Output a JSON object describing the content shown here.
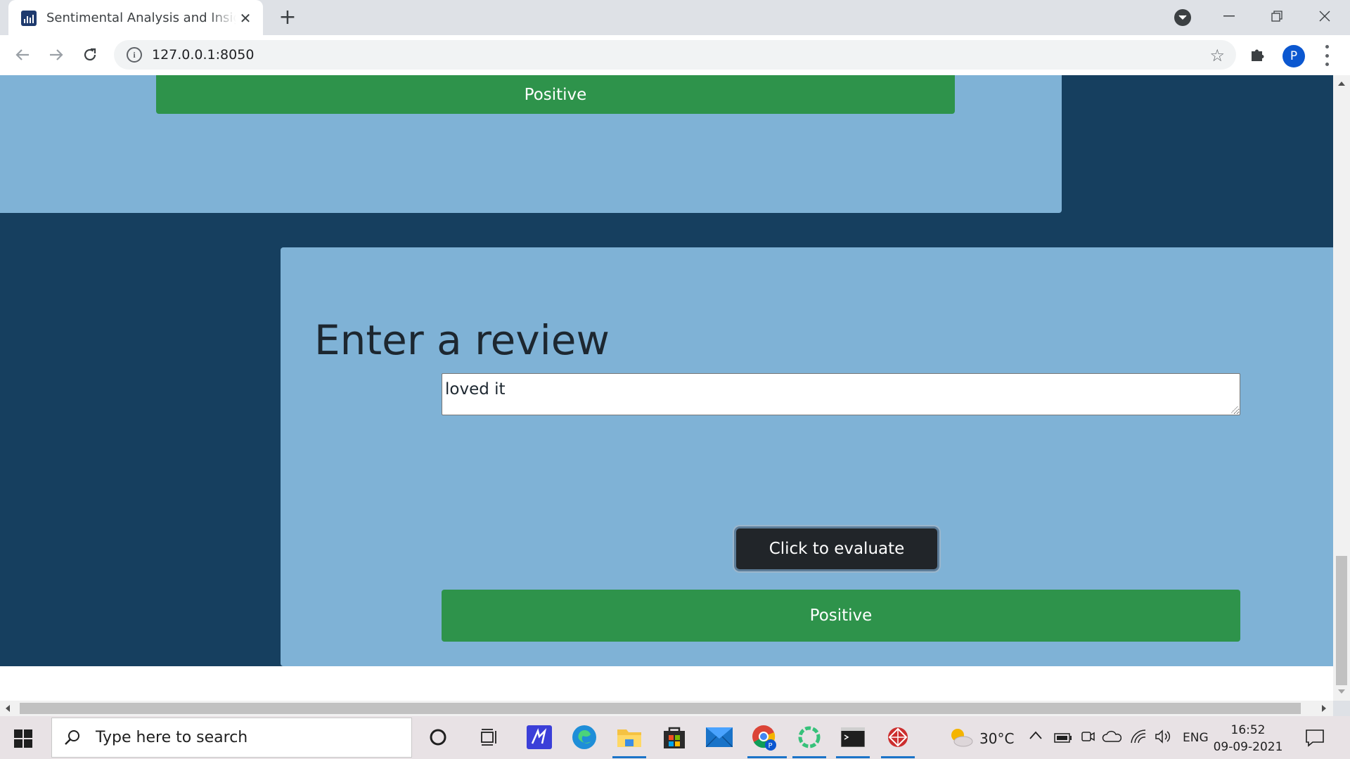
{
  "browser": {
    "tab_title": "Sentimental Analysis and Insights",
    "url": "127.0.0.1:8050",
    "profile_initial": "P"
  },
  "page": {
    "top_result": "Positive",
    "heading": "Enter a review",
    "review_value": "loved it",
    "evaluate_label": "Click to evaluate",
    "result": "Positive"
  },
  "taskbar": {
    "search_placeholder": "Type here to search",
    "weather": "30°C",
    "language": "ENG",
    "time": "16:52",
    "date": "09-09-2021"
  },
  "colors": {
    "page_background": "#163f5f",
    "card_background": "#7fb2d6",
    "success": "#2e934b",
    "button_dark": "#212529"
  },
  "icons": [
    "app-favicon-icon",
    "close-icon",
    "plus-icon",
    "chevron-down-icon",
    "minimize-icon",
    "restore-icon",
    "back-icon",
    "forward-icon",
    "reload-icon",
    "info-icon",
    "star-icon",
    "puzzle-icon",
    "kebab-menu-icon",
    "windows-start-icon",
    "search-icon",
    "cortana-icon",
    "task-view-icon",
    "edge-icon",
    "file-explorer-icon",
    "store-icon",
    "mail-icon",
    "chrome-icon",
    "terminal-icon",
    "weather-icon",
    "battery-icon",
    "wifi-icon",
    "volume-icon",
    "notification-icon"
  ]
}
